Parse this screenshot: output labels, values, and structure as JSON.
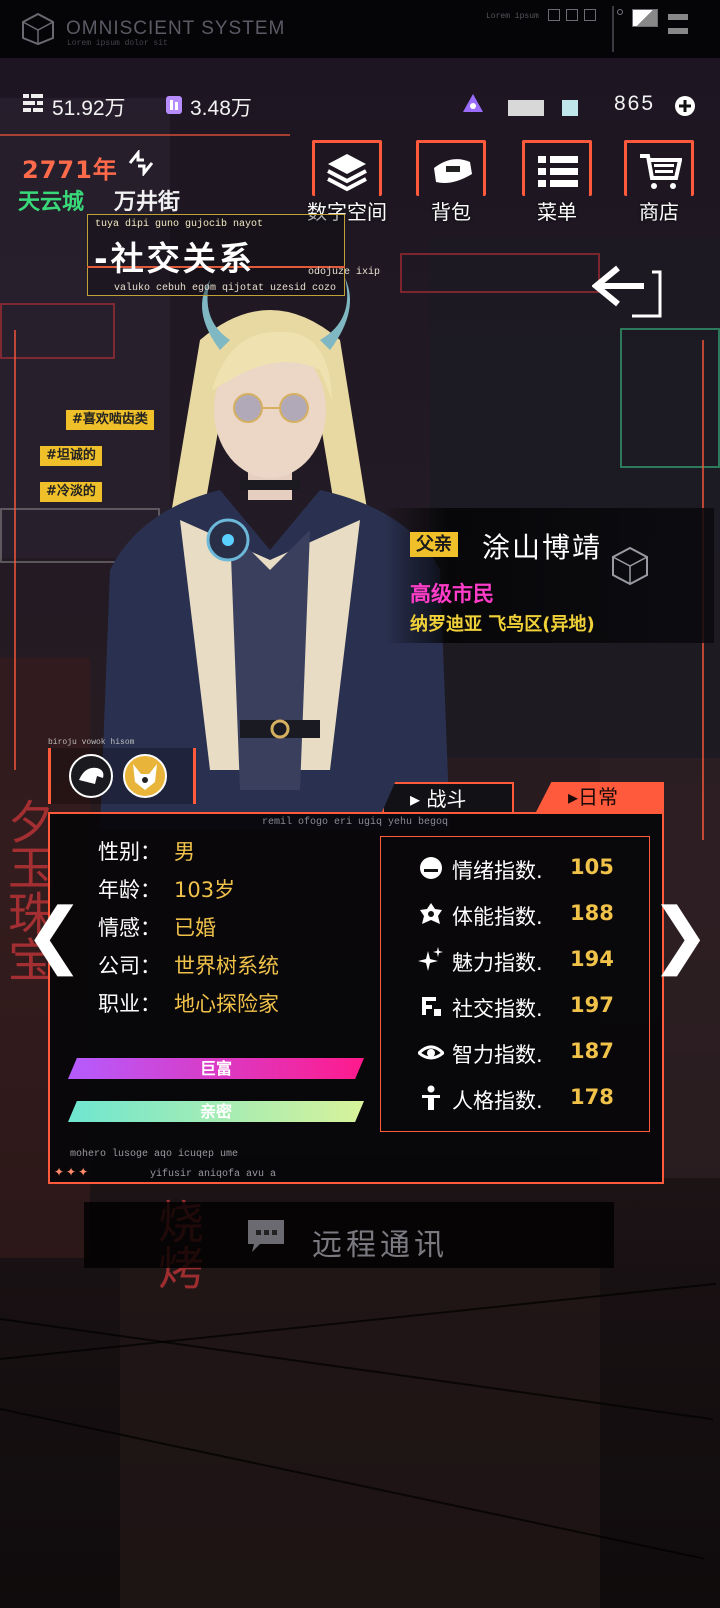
{
  "system": {
    "title": "OMNISCIENT SYSTEM",
    "subtitle": "Lorem ipsum dolor sit",
    "corner_text": "Lorem ipsum"
  },
  "currency": {
    "coins": "51.92万",
    "gems": "3.48万",
    "energy": "865"
  },
  "location": {
    "year": "2771年",
    "city": "天云城",
    "street": "万井街"
  },
  "top_buttons": [
    {
      "label": "数字空间",
      "icon": "layers-icon"
    },
    {
      "label": "背包",
      "icon": "pouch-icon"
    },
    {
      "label": "菜单",
      "icon": "menu-list-icon"
    },
    {
      "label": "商店",
      "icon": "cart-icon"
    }
  ],
  "page": {
    "title": "社交关系",
    "small_text": "tuya dipi guno gujocib nayot",
    "under_text": "valuko cebuh egom qijotat uzesid cozo",
    "side_text": "odojuze ixip"
  },
  "tags": [
    "#喜欢啮齿类",
    "#坦诚的",
    "#冷淡的"
  ],
  "character": {
    "relation": "父亲",
    "name": "涂山博靖",
    "rank": "高级市民",
    "residence": "纳罗迪亚 飞鸟区(异地)"
  },
  "badges_caption": "biroju vowok hisom",
  "tabs": {
    "battle": "战斗",
    "daily": "日常",
    "active": "daily"
  },
  "panel_caption": "remil ofogo eri ugiq yehu begoq",
  "profile": [
    {
      "label": "性别：",
      "value": "男"
    },
    {
      "label": "年龄：",
      "value": "103岁"
    },
    {
      "label": "情感：",
      "value": "已婚"
    },
    {
      "label": "公司：",
      "value": "世界树系统"
    },
    {
      "label": "职业：",
      "value": "地心探险家"
    }
  ],
  "bars": [
    {
      "label": "巨富",
      "color_from": "#b45cff",
      "color_to": "#ff1a8c"
    },
    {
      "label": "亲密",
      "color_from": "#6ee6d0",
      "color_to": "#d8f29a"
    }
  ],
  "stats": [
    {
      "label": "情绪指数.",
      "value": "105",
      "icon": "mood-icon"
    },
    {
      "label": "体能指数.",
      "value": "188",
      "icon": "stamina-icon"
    },
    {
      "label": "魅力指数.",
      "value": "194",
      "icon": "sparkle-icon"
    },
    {
      "label": "社交指数.",
      "value": "197",
      "icon": "social-icon"
    },
    {
      "label": "智力指数.",
      "value": "187",
      "icon": "eye-icon"
    },
    {
      "label": "人格指数.",
      "value": "178",
      "icon": "person-icon"
    }
  ],
  "panel_footer": {
    "line1": "mohero lusoge aqo icuqep ume",
    "line2": "yifusir aniqofa avu a"
  },
  "comm_button": {
    "label": "远程通讯"
  },
  "colors": {
    "accent": "#ff5a3c",
    "gold": "#f0c24a",
    "rank": "#ff3dc8",
    "city": "#39d97a"
  }
}
